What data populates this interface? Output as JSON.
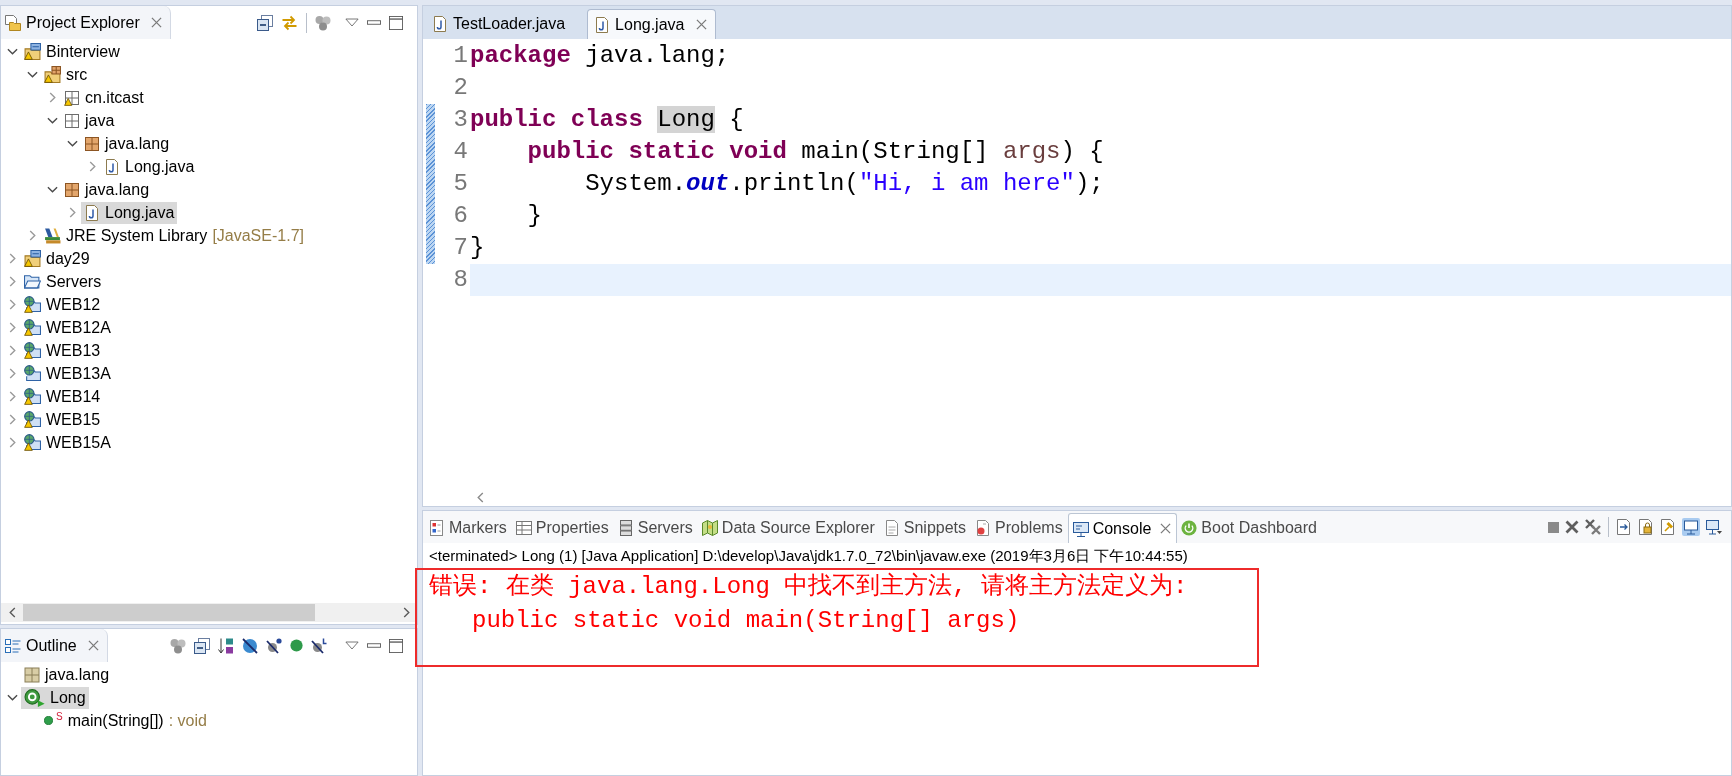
{
  "project_explorer": {
    "title": "Project Explorer",
    "tree": [
      {
        "label": "Binterview",
        "kind": "project",
        "warning": true,
        "expanded": true,
        "selected": false,
        "children": [
          {
            "label": "src",
            "kind": "source-folder",
            "warning": true,
            "expanded": true,
            "selected": false,
            "children": [
              {
                "label": "cn.itcast",
                "kind": "package-outline",
                "warning": true,
                "expanded": false,
                "selected": false
              },
              {
                "label": "java",
                "kind": "package-outline",
                "warning": false,
                "expanded": true,
                "selected": false,
                "children": [
                  {
                    "label": "java.lang",
                    "kind": "package",
                    "warning": false,
                    "expanded": true,
                    "selected": false,
                    "children": [
                      {
                        "label": "Long.java",
                        "kind": "java-file",
                        "warning": false,
                        "expanded": false,
                        "selected": false
                      }
                    ]
                  }
                ]
              },
              {
                "label": "java.lang",
                "kind": "package",
                "warning": false,
                "expanded": true,
                "selected": false,
                "children": [
                  {
                    "label": "Long.java",
                    "kind": "java-file",
                    "warning": false,
                    "expanded": false,
                    "selected": true
                  }
                ]
              }
            ]
          },
          {
            "label": "JRE System Library",
            "decoration": "[JavaSE-1.7]",
            "kind": "library",
            "warning": false,
            "expanded": false,
            "selected": false
          }
        ]
      },
      {
        "label": "day29",
        "kind": "project",
        "warning": true,
        "expanded": false,
        "selected": false
      },
      {
        "label": "Servers",
        "kind": "folder",
        "warning": false,
        "expanded": false,
        "selected": false
      },
      {
        "label": "WEB12",
        "kind": "web-project",
        "warning": true,
        "expanded": false,
        "selected": false
      },
      {
        "label": "WEB12A",
        "kind": "web-project",
        "warning": true,
        "expanded": false,
        "selected": false
      },
      {
        "label": "WEB13",
        "kind": "web-project",
        "warning": true,
        "expanded": false,
        "selected": false
      },
      {
        "label": "WEB13A",
        "kind": "web-project",
        "warning": false,
        "expanded": false,
        "selected": false
      },
      {
        "label": "WEB14",
        "kind": "web-project",
        "warning": true,
        "expanded": false,
        "selected": false
      },
      {
        "label": "WEB15",
        "kind": "web-project",
        "warning": true,
        "expanded": false,
        "selected": false
      },
      {
        "label": "WEB15A",
        "kind": "web-project",
        "warning": true,
        "expanded": false,
        "selected": false
      }
    ]
  },
  "outline": {
    "title": "Outline",
    "tree": [
      {
        "label": "java.lang",
        "kind": "package-declaration",
        "selected": false
      },
      {
        "label": "Long",
        "kind": "class",
        "expanded": true,
        "selected": true,
        "children": [
          {
            "label": "main(String[])",
            "detail": ": void",
            "overlay": "S",
            "kind": "method",
            "selected": false
          }
        ]
      }
    ]
  },
  "editor": {
    "tabs": [
      {
        "label": "TestLoader.java",
        "selected": false
      },
      {
        "label": "Long.java",
        "selected": true
      }
    ],
    "lines": [
      {
        "number": "1",
        "changed": false,
        "current": false,
        "tokens": [
          {
            "kind": "keyword",
            "text": "package"
          },
          {
            "kind": "plain",
            "text": " java.lang;"
          }
        ]
      },
      {
        "number": "2",
        "changed": false,
        "current": false
      },
      {
        "number": "3",
        "changed": true,
        "current": false,
        "tokens": [
          {
            "kind": "keyword",
            "text": "public class "
          },
          {
            "kind": "occurrence",
            "text": "Long"
          },
          {
            "kind": "plain",
            "text": " {"
          }
        ],
        "children": [
          {
            "number": "4",
            "changed": true,
            "current": false,
            "tokens": [
              {
                "kind": "keyword",
                "text": "public static void"
              },
              {
                "kind": "plain",
                "text": " main(String[] "
              },
              {
                "kind": "parameter",
                "text": "args"
              },
              {
                "kind": "plain",
                "text": ") {"
              }
            ],
            "children": [
              {
                "number": "5",
                "changed": true,
                "current": false,
                "tokens": [
                  {
                    "kind": "plain",
                    "text": "System."
                  },
                  {
                    "kind": "static-field",
                    "text": "out"
                  },
                  {
                    "kind": "plain",
                    "text": ".println("
                  },
                  {
                    "kind": "string",
                    "text": "\"Hi, i am here\""
                  },
                  {
                    "kind": "plain",
                    "text": ");"
                  }
                ]
              }
            ]
          },
          {
            "number": "6",
            "changed": true,
            "current": false,
            "tokens": [
              {
                "kind": "plain",
                "text": "}"
              }
            ]
          }
        ]
      },
      {
        "number": "7",
        "changed": true,
        "current": false,
        "tokens": [
          {
            "kind": "plain",
            "text": "}"
          }
        ]
      },
      {
        "number": "8",
        "changed": false,
        "current": true
      }
    ]
  },
  "bottom_panel": {
    "tabs": [
      {
        "label": "Markers",
        "kind": "markers",
        "selected": false
      },
      {
        "label": "Properties",
        "kind": "properties",
        "selected": false
      },
      {
        "label": "Servers",
        "kind": "servers",
        "selected": false
      },
      {
        "label": "Data Source Explorer",
        "kind": "data-source",
        "selected": false
      },
      {
        "label": "Snippets",
        "kind": "snippets",
        "selected": false
      },
      {
        "label": "Problems",
        "kind": "problems",
        "selected": false
      },
      {
        "label": "Console",
        "kind": "console",
        "selected": true
      },
      {
        "label": "Boot Dashboard",
        "kind": "dashboard",
        "selected": false
      }
    ],
    "console": {
      "status": "<terminated> Long (1) [Java Application] D:\\develop\\Java\\jdk1.7.0_72\\bin\\javaw.exe (2019年3月6日 下午10:44:55)",
      "lines": [
        {
          "text": "错误: 在类 java.lang.Long 中找不到主方法, 请将主方法定义为:",
          "children": [
            {
              "text": "public static void main(String[] args)"
            }
          ]
        }
      ]
    }
  }
}
